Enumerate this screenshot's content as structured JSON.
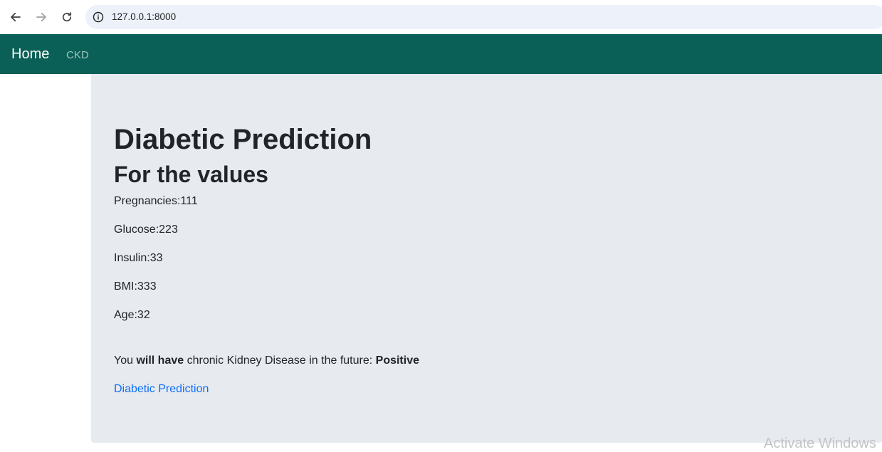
{
  "browser": {
    "url": "127.0.0.1:8000"
  },
  "navbar": {
    "brand": "Home",
    "links": [
      "CKD"
    ]
  },
  "main": {
    "title": "Diabetic Prediction",
    "subtitle": "For the values",
    "values": [
      "Pregnancies:111",
      "Glucose:223",
      "Insulin:33",
      "BMI:333",
      "Age:32"
    ],
    "result": {
      "prefix": "You ",
      "emphasis": "will have",
      "middle": " chronic Kidney Disease in the future: ",
      "outcome": "Positive"
    },
    "link_label": "Diabetic Prediction"
  },
  "watermark": "Activate Windows"
}
